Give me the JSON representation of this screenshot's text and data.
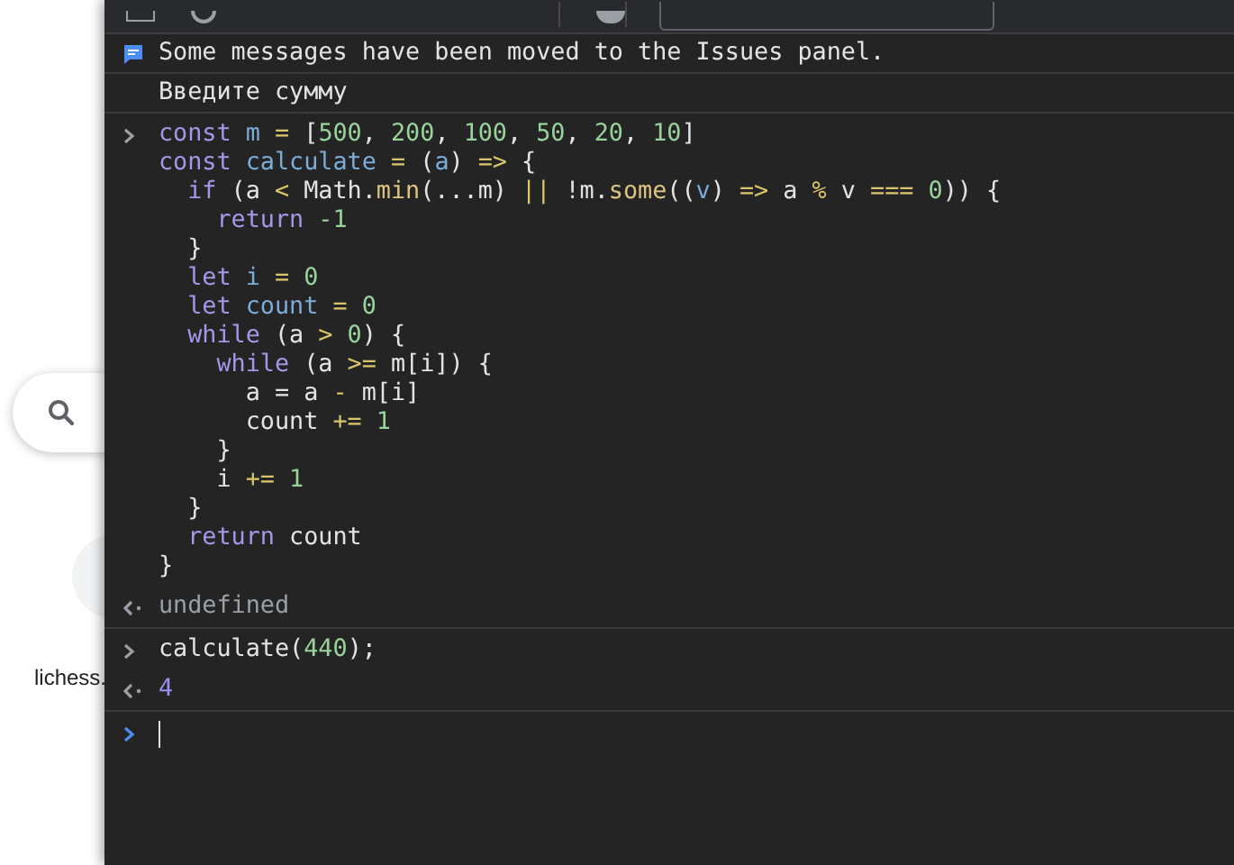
{
  "page": {
    "site_label": "lichess."
  },
  "messages": [
    {
      "kind": "info",
      "text": "Some messages have been moved to the Issues panel."
    },
    {
      "kind": "log",
      "text": "Введите сумму"
    }
  ],
  "entries": [
    {
      "kind": "input",
      "lines": [
        {
          "tokens": [
            {
              "kind": "kw",
              "text": "const "
            },
            {
              "kind": "def",
              "text": "m"
            },
            {
              "kind": "op",
              "text": " = "
            },
            {
              "kind": "p",
              "text": "["
            },
            {
              "kind": "num",
              "text": "500"
            },
            {
              "kind": "p",
              "text": ", "
            },
            {
              "kind": "num",
              "text": "200"
            },
            {
              "kind": "p",
              "text": ", "
            },
            {
              "kind": "num",
              "text": "100"
            },
            {
              "kind": "p",
              "text": ", "
            },
            {
              "kind": "num",
              "text": "50"
            },
            {
              "kind": "p",
              "text": ", "
            },
            {
              "kind": "num",
              "text": "20"
            },
            {
              "kind": "p",
              "text": ", "
            },
            {
              "kind": "num",
              "text": "10"
            },
            {
              "kind": "p",
              "text": "]"
            }
          ]
        },
        {
          "tokens": [
            {
              "kind": "kw",
              "text": "const "
            },
            {
              "kind": "def",
              "text": "calculate"
            },
            {
              "kind": "op",
              "text": " = "
            },
            {
              "kind": "p",
              "text": "("
            },
            {
              "kind": "def",
              "text": "a"
            },
            {
              "kind": "p",
              "text": ") "
            },
            {
              "kind": "op",
              "text": "=>"
            },
            {
              "kind": "p",
              "text": " {"
            }
          ],
          "children": [
            {
              "tokens": [
                {
                  "kind": "kw",
                  "text": "if "
                },
                {
                  "kind": "p",
                  "text": "(a "
                },
                {
                  "kind": "op",
                  "text": "<"
                },
                {
                  "kind": "p",
                  "text": " Math."
                },
                {
                  "kind": "fn",
                  "text": "min"
                },
                {
                  "kind": "p",
                  "text": "(...m) "
                },
                {
                  "kind": "op",
                  "text": "||"
                },
                {
                  "kind": "p",
                  "text": " !m."
                },
                {
                  "kind": "fn",
                  "text": "some"
                },
                {
                  "kind": "p",
                  "text": "(("
                },
                {
                  "kind": "def",
                  "text": "v"
                },
                {
                  "kind": "p",
                  "text": ") "
                },
                {
                  "kind": "op",
                  "text": "=>"
                },
                {
                  "kind": "p",
                  "text": " a "
                },
                {
                  "kind": "op",
                  "text": "%"
                },
                {
                  "kind": "p",
                  "text": " v "
                },
                {
                  "kind": "op",
                  "text": "=== "
                },
                {
                  "kind": "num",
                  "text": "0"
                },
                {
                  "kind": "p",
                  "text": ")) {"
                }
              ],
              "children": [
                {
                  "tokens": [
                    {
                      "kind": "kw",
                      "text": "return "
                    },
                    {
                      "kind": "num",
                      "text": "-1"
                    }
                  ]
                }
              ]
            },
            {
              "tokens": [
                {
                  "kind": "p",
                  "text": "}"
                }
              ]
            },
            {
              "tokens": [
                {
                  "kind": "kw",
                  "text": "let "
                },
                {
                  "kind": "def",
                  "text": "i"
                },
                {
                  "kind": "op",
                  "text": " = "
                },
                {
                  "kind": "num",
                  "text": "0"
                }
              ]
            },
            {
              "tokens": [
                {
                  "kind": "kw",
                  "text": "let "
                },
                {
                  "kind": "def",
                  "text": "count"
                },
                {
                  "kind": "op",
                  "text": " = "
                },
                {
                  "kind": "num",
                  "text": "0"
                }
              ]
            },
            {
              "tokens": [
                {
                  "kind": "kw",
                  "text": "while "
                },
                {
                  "kind": "p",
                  "text": "(a "
                },
                {
                  "kind": "op",
                  "text": "> "
                },
                {
                  "kind": "num",
                  "text": "0"
                },
                {
                  "kind": "p",
                  "text": ") {"
                }
              ],
              "children": [
                {
                  "tokens": [
                    {
                      "kind": "kw",
                      "text": "while "
                    },
                    {
                      "kind": "p",
                      "text": "(a "
                    },
                    {
                      "kind": "op",
                      "text": ">="
                    },
                    {
                      "kind": "p",
                      "text": " m[i]) {"
                    }
                  ],
                  "children": [
                    {
                      "tokens": [
                        {
                          "kind": "p",
                          "text": "a = a "
                        },
                        {
                          "kind": "op",
                          "text": "-"
                        },
                        {
                          "kind": "p",
                          "text": " m[i]"
                        }
                      ]
                    },
                    {
                      "tokens": [
                        {
                          "kind": "p",
                          "text": "count "
                        },
                        {
                          "kind": "op",
                          "text": "+= "
                        },
                        {
                          "kind": "num",
                          "text": "1"
                        }
                      ]
                    }
                  ]
                },
                {
                  "tokens": [
                    {
                      "kind": "p",
                      "text": "}"
                    }
                  ]
                },
                {
                  "tokens": [
                    {
                      "kind": "p",
                      "text": "i "
                    },
                    {
                      "kind": "op",
                      "text": "+= "
                    },
                    {
                      "kind": "num",
                      "text": "1"
                    }
                  ]
                }
              ]
            },
            {
              "tokens": [
                {
                  "kind": "p",
                  "text": "}"
                }
              ]
            },
            {
              "tokens": [
                {
                  "kind": "kw",
                  "text": "return "
                },
                {
                  "kind": "p",
                  "text": "count"
                }
              ]
            }
          ]
        },
        {
          "tokens": [
            {
              "kind": "p",
              "text": "}"
            }
          ]
        }
      ]
    },
    {
      "kind": "undefined_result",
      "text": "undefined"
    },
    {
      "kind": "input",
      "lines": [
        {
          "tokens": [
            {
              "kind": "p",
              "text": "calculate("
            },
            {
              "kind": "num",
              "text": "440"
            },
            {
              "kind": "p",
              "text": ");"
            }
          ]
        }
      ]
    },
    {
      "kind": "number_result",
      "text": "4"
    },
    {
      "kind": "prompt"
    }
  ]
}
